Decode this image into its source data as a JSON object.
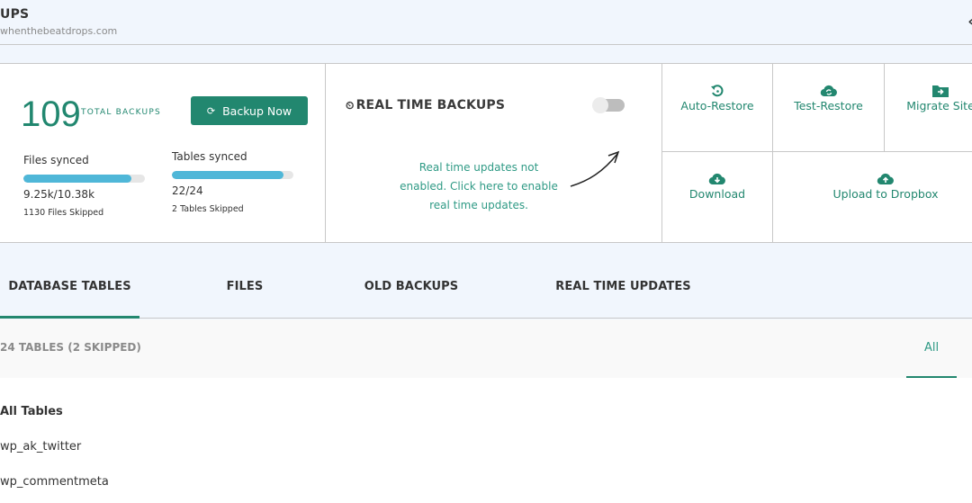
{
  "header": {
    "title": "UPS",
    "subtitle": "whenthebeatdrops.com",
    "collapse_icon": "chevron-left-icon",
    "collapse_glyph": "‹"
  },
  "stats": {
    "total_backups": "109",
    "total_label": "TOTAL BACKUPS",
    "backup_button": {
      "label": "Backup Now",
      "icon": "sync-icon",
      "glyph": "⟳"
    },
    "files": {
      "label": "Files synced",
      "value": "9.25k/10.38k",
      "progress_percent": 89,
      "skipped": "1130 Files Skipped"
    },
    "tables": {
      "label": "Tables synced",
      "value": "22/24",
      "progress_percent": 92,
      "skipped": "2 Tables Skipped"
    }
  },
  "realtime": {
    "title": "REAL TIME BACKUPS",
    "icon": "timer-icon",
    "glyph": "⏲",
    "toggle_enabled": false,
    "message": "Real time updates not enabled. Click here to enable real time updates."
  },
  "actions": {
    "auto_restore": "Auto-Restore",
    "test_restore": "Test-Restore",
    "migrate_site": "Migrate Site",
    "download": "Download",
    "upload_dropbox": "Upload to Dropbox"
  },
  "tabs": [
    {
      "label": "DATABASE TABLES",
      "active": true
    },
    {
      "label": "FILES",
      "active": false
    },
    {
      "label": "OLD BACKUPS",
      "active": false
    },
    {
      "label": "REAL TIME UPDATES",
      "active": false
    }
  ],
  "subbar": {
    "count": "24 TABLES (2 SKIPPED)",
    "filter": "All"
  },
  "list": {
    "header": "All Tables",
    "items": [
      "wp_ak_twitter",
      "wp_commentmeta"
    ]
  },
  "colors": {
    "accent": "#22876f",
    "progress": "#4fb7d8",
    "background": "#f1f6fd"
  }
}
